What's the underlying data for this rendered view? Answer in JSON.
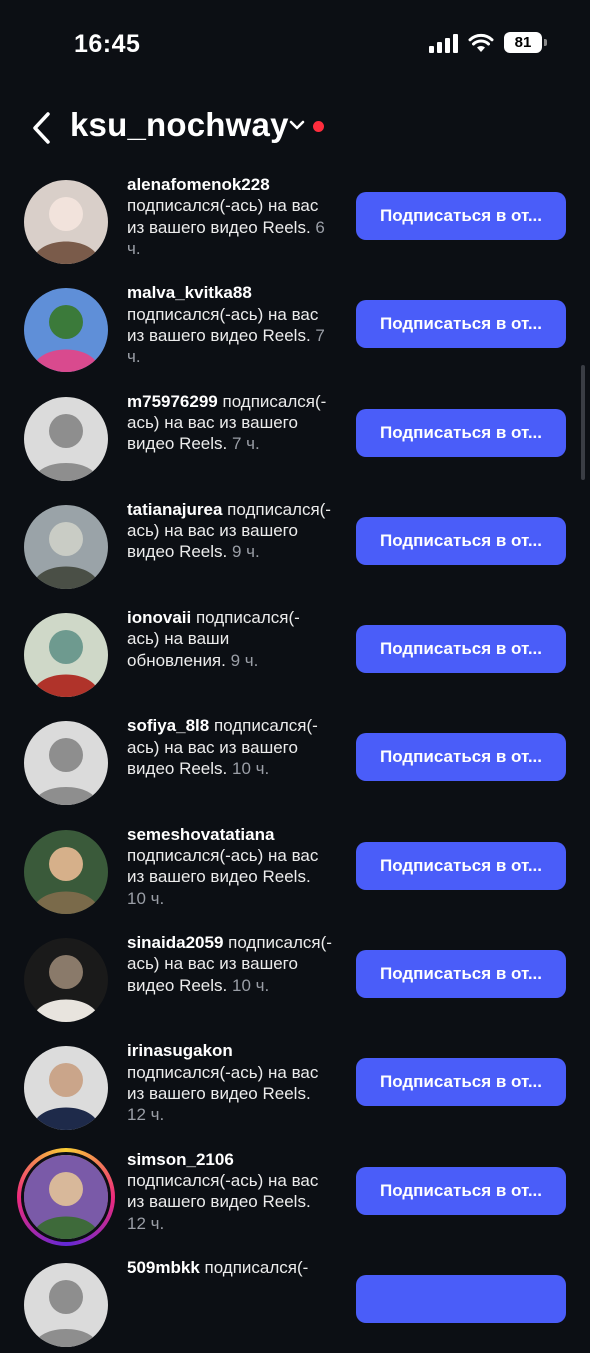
{
  "status_bar": {
    "time": "16:45",
    "battery": "81"
  },
  "header": {
    "title": "ksu_nochway"
  },
  "rows": [
    {
      "username": "alenafomenok228",
      "action": " подписался(-ась) на вас из вашего видео Reels.",
      "time": " 6 ч.",
      "button": "Подписаться в от...",
      "avatar": "photo",
      "colors": [
        "#d9cfc9",
        "#7a5b4a",
        "#f2e3dc"
      ]
    },
    {
      "username": "malva_kvitka88",
      "action": " подписался(-ась) на вас из вашего видео Reels.",
      "time": " 7 ч.",
      "button": "Подписаться в от...",
      "avatar": "photo",
      "colors": [
        "#5f8fd8",
        "#d94a8e",
        "#3b7a3a"
      ]
    },
    {
      "username": "m75976299",
      "action": " подписался(-ась) на вас из вашего видео Reels.",
      "time": " 7 ч.",
      "button": "Подписаться в от...",
      "avatar": "default"
    },
    {
      "username": "tatianajurea",
      "action": " подписался(-ась) на вас из вашего видео Reels.",
      "time": " 9 ч.",
      "button": "Подписаться в от...",
      "avatar": "photo",
      "colors": [
        "#9aa3a8",
        "#4a4f46",
        "#c9ccc5"
      ]
    },
    {
      "username": "ionovaii",
      "action": " подписался(-ась) на ваши обновления.",
      "time": " 9 ч.",
      "button": "Подписаться в от...",
      "avatar": "photo",
      "colors": [
        "#cfd8c8",
        "#b0332a",
        "#6e9a8f"
      ]
    },
    {
      "username": "sofiya_8l8",
      "action": " подписался(-ась) на вас из вашего видео Reels.",
      "time": " 10 ч.",
      "button": "Подписаться в от...",
      "avatar": "default"
    },
    {
      "username": "semeshovatatiana",
      "action": " подписался(-ась) на вас из вашего видео Reels.",
      "time": " 10 ч.",
      "button": "Подписаться в от...",
      "avatar": "photo",
      "colors": [
        "#3a5a3a",
        "#7a6a4a",
        "#d6b08a"
      ]
    },
    {
      "username": "sinaida2059",
      "action": " подписался(-ась) на вас из вашего видео Reels.",
      "time": " 10 ч.",
      "button": "Подписаться в от...",
      "avatar": "photo",
      "colors": [
        "#1a1a1a",
        "#e8e4de",
        "#8a7a6a"
      ]
    },
    {
      "username": "irinasugakon",
      "action": " подписался(-ась) на вас из вашего видео Reels.",
      "time": " 12 ч.",
      "button": "Подписаться в от...",
      "avatar": "photo",
      "colors": [
        "#dcdcdc",
        "#1e2a4a",
        "#caa58a"
      ]
    },
    {
      "username": "simson_2106",
      "action": " подписался(-ась) на вас из вашего видео Reels.",
      "time": " 12 ч.",
      "button": "Подписаться в от...",
      "avatar": "ring",
      "colors": [
        "#7a5aa8",
        "#3e6a3a",
        "#d8b89a"
      ]
    },
    {
      "username": "509mbkk",
      "action": " подписался(-",
      "time": "",
      "button": "",
      "avatar": "default"
    }
  ]
}
